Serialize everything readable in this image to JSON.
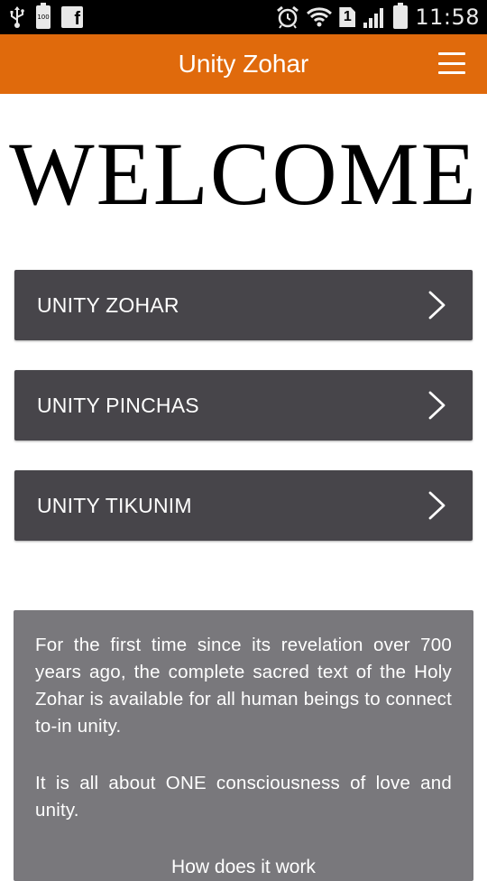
{
  "status_bar": {
    "battery_small_label": "100",
    "facebook_glyph": "f",
    "sim_label": "1",
    "time": "11:58",
    "icons": [
      "usb-icon",
      "battery-full-icon",
      "facebook-icon",
      "alarm-icon",
      "wifi-icon",
      "sim-icon",
      "signal-icon",
      "battery-icon"
    ]
  },
  "header": {
    "title": "Unity Zohar",
    "menu_icon": "hamburger-menu-icon",
    "color": "#e06a0c"
  },
  "welcome": {
    "title": "WELCOME"
  },
  "nav": {
    "items": [
      {
        "label": "UNITY ZOHAR",
        "icon": "chevron-right-icon"
      },
      {
        "label": "UNITY PINCHAS",
        "icon": "chevron-right-icon"
      },
      {
        "label": "UNITY TIKUNIM",
        "icon": "chevron-right-icon"
      }
    ],
    "color": "#47454a"
  },
  "info": {
    "paragraph1": "For the first time since its revelation over 700 years ago, the complete sacred text of the Holy Zohar is available for all human beings to connect to-in unity.",
    "paragraph2": "It is all about ONE consciousness of love and unity.",
    "link": "How does it work",
    "color": "#79787c"
  }
}
